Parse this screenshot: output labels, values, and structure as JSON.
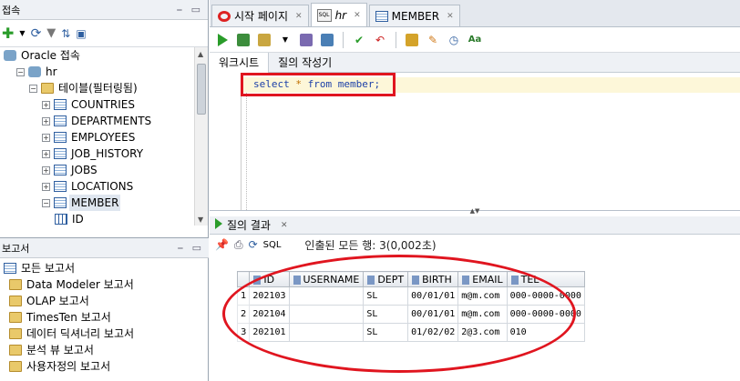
{
  "connections": {
    "title": "접속",
    "tree": [
      {
        "label": "Oracle 접속",
        "icon": "oracle-connections-icon",
        "level": 0
      },
      {
        "label": "hr",
        "icon": "database-connection-icon",
        "level": 1
      },
      {
        "label": "테이블(필터링됨)",
        "icon": "tables-folder-icon",
        "level": 2
      },
      {
        "label": "COUNTRIES",
        "icon": "table-icon",
        "level": 3
      },
      {
        "label": "DEPARTMENTS",
        "icon": "table-icon",
        "level": 3
      },
      {
        "label": "EMPLOYEES",
        "icon": "table-icon",
        "level": 3
      },
      {
        "label": "JOB_HISTORY",
        "icon": "table-icon",
        "level": 3
      },
      {
        "label": "JOBS",
        "icon": "table-icon",
        "level": 3
      },
      {
        "label": "LOCATIONS",
        "icon": "table-icon",
        "level": 3
      },
      {
        "label": "MEMBER",
        "icon": "table-icon",
        "level": 3,
        "selected": true
      },
      {
        "label": "ID",
        "icon": "column-icon",
        "level": 4
      }
    ]
  },
  "reports": {
    "title": "보고서",
    "items": [
      {
        "label": "모든 보고서",
        "icon": "reports-icon"
      },
      {
        "label": "Data Modeler 보고서",
        "icon": "folder-icon"
      },
      {
        "label": "OLAP 보고서",
        "icon": "folder-icon"
      },
      {
        "label": "TimesTen 보고서",
        "icon": "folder-icon"
      },
      {
        "label": "데이터 딕셔너리 보고서",
        "icon": "folder-icon"
      },
      {
        "label": "분석 뷰 보고서",
        "icon": "folder-icon"
      },
      {
        "label": "사용자정의 보고서",
        "icon": "folder-icon"
      }
    ]
  },
  "editor_tabs": [
    {
      "label": "시작 페이지",
      "icon": "oracle-icon"
    },
    {
      "label": "hr",
      "icon": "sql-worksheet-icon",
      "active": true
    },
    {
      "label": "MEMBER",
      "icon": "table-icon"
    }
  ],
  "sub_tabs": {
    "worksheet": "워크시트",
    "query_builder": "질의 작성기"
  },
  "editor": {
    "sql_before": "select ",
    "sql_star": "*",
    "sql_after": " from member;"
  },
  "results": {
    "tab_label": "질의 결과",
    "sql_label": "SQL",
    "status": "인출된 모든 행: 3(0,002초)",
    "columns": [
      "ID",
      "USERNAME",
      "DEPT",
      "BIRTH",
      "EMAIL",
      "TEL"
    ],
    "rows": [
      {
        "num": "1",
        "cells": [
          "202103",
          "",
          "SL",
          "00/01/01",
          "m@m.com",
          "000-0000-0000"
        ]
      },
      {
        "num": "2",
        "cells": [
          "202104",
          "",
          "SL",
          "00/01/01",
          "m@m.com",
          "000-0000-0000"
        ]
      },
      {
        "num": "3",
        "cells": [
          "202101",
          "",
          "SL",
          "01/02/02",
          "2@3.com",
          "010"
        ]
      }
    ]
  },
  "colors": {
    "accent": "#2f5fa0",
    "annotation": "#e0151f",
    "keyword": "#1b3fa8"
  }
}
